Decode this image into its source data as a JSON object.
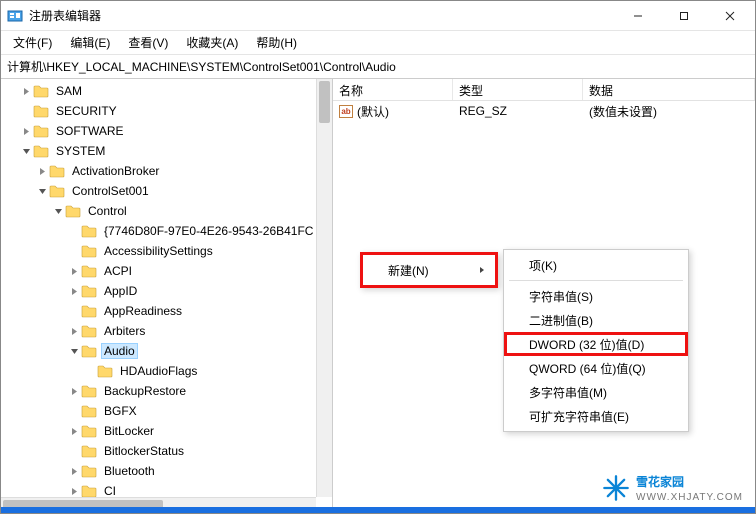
{
  "title": "注册表编辑器",
  "menu": {
    "file": "文件(F)",
    "edit": "编辑(E)",
    "view": "查看(V)",
    "fav": "收藏夹(A)",
    "help": "帮助(H)"
  },
  "address": "计算机\\HKEY_LOCAL_MACHINE\\SYSTEM\\ControlSet001\\Control\\Audio",
  "list_header": {
    "name": "名称",
    "type": "类型",
    "data": "数据"
  },
  "default_value": {
    "name": "(默认)",
    "type": "REG_SZ",
    "data": "(数值未设置)"
  },
  "tree": {
    "sam": "SAM",
    "security": "SECURITY",
    "software": "SOFTWARE",
    "system": "SYSTEM",
    "activationbroker": "ActivationBroker",
    "controlset001": "ControlSet001",
    "control": "Control",
    "guid": "{7746D80F-97E0-4E26-9543-26B41FC",
    "accessibility": "AccessibilitySettings",
    "acpi": "ACPI",
    "appid": "AppID",
    "appreadiness": "AppReadiness",
    "arbiters": "Arbiters",
    "audio": "Audio",
    "hdaudioflags": "HDAudioFlags",
    "backuprestore": "BackupRestore",
    "bgfx": "BGFX",
    "bitlocker": "BitLocker",
    "bitlockerstatus": "BitlockerStatus",
    "bluetooth": "Bluetooth",
    "ci": "CI"
  },
  "ctx": {
    "new": "新建(N)",
    "key": "项(K)",
    "string": "字符串值(S)",
    "binary": "二进制值(B)",
    "dword": "DWORD (32 位)值(D)",
    "qword": "QWORD (64 位)值(Q)",
    "multi": "多字符串值(M)",
    "expand": "可扩充字符串值(E)"
  },
  "watermark": {
    "text": "雪花家园",
    "sub": "WWW.XHJATY.COM"
  }
}
